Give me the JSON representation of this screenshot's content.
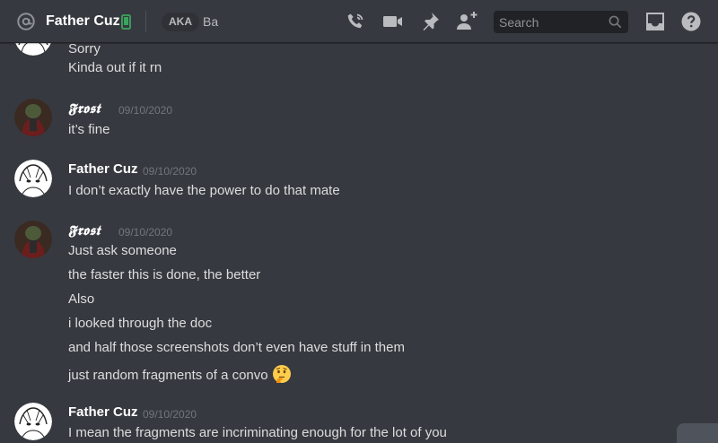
{
  "header": {
    "channel_name": "Father Cuz",
    "aka_label": "AKA",
    "aka_value": "Ba",
    "search_placeholder": "Search",
    "icons": [
      "at-icon",
      "mobile-icon",
      "voice-call-icon",
      "video-call-icon",
      "pin-icon",
      "add-friend-icon",
      "search-icon",
      "inbox-icon",
      "help-icon"
    ]
  },
  "messages": [
    {
      "author": "",
      "timestamp": "",
      "lines": [
        "Sorry",
        "Kinda out if it rn"
      ]
    },
    {
      "author": "𝕱𝖗𝖔𝖘𝖙",
      "timestamp": "09/10/2020",
      "lines": [
        "it’s fine"
      ]
    },
    {
      "author": "Father Cuz",
      "timestamp": "09/10/2020",
      "lines": [
        "I don’t exactly have the power to do that mate"
      ]
    },
    {
      "author": "𝕱𝖗𝖔𝖘𝖙",
      "timestamp": "09/10/2020",
      "lines": [
        "Just ask someone",
        "the faster this is done, the better",
        "Also",
        "i looked through the doc",
        "and half those screenshots don’t even have stuff in them",
        "just random fragments of a convo"
      ],
      "emoji": "thinking-face-emoji"
    },
    {
      "author": "Father Cuz",
      "timestamp": "09/10/2020",
      "lines": [
        "I mean the fragments are incriminating enough for the lot of you"
      ]
    }
  ],
  "colors": {
    "background": "#36393f",
    "header_text": "#ffffff",
    "message_text": "#dcddde",
    "timestamp": "#72767d",
    "search_bg": "#202225",
    "online_mobile": "#3ba55d"
  }
}
